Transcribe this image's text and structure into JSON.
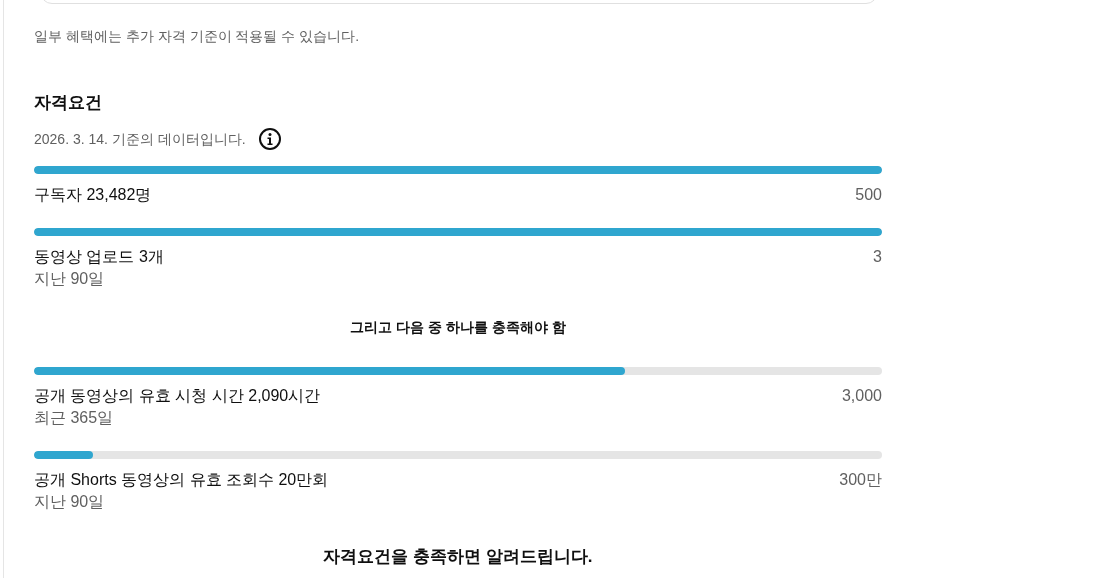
{
  "notice": "일부 혜택에는 추가 자격 기준이 적용될 수 있습니다.",
  "section": {
    "title": "자격요건",
    "as_of": "2026. 3. 14. 기준의 데이터입니다."
  },
  "required": [
    {
      "label": "구독자 23,482명",
      "target": "500",
      "level": 1
    },
    {
      "label": "동영상 업로드 3개",
      "period": "지난 90일",
      "target": "3",
      "level": 1
    }
  ],
  "divider_text": "그리고 다음 중 하나를 충족해야 함",
  "alternatives": [
    {
      "label": "공개 동영상의 유효 시청 시간 2,090시간",
      "period": "최근 365일",
      "target": "3,000",
      "level": 0.697
    },
    {
      "label": "공개 Shorts 동영상의 유효 조회수 20만회",
      "period": "지난 90일",
      "target": "300만",
      "level": 0.07
    }
  ],
  "footer": "자격요건을 충족하면 알려드립니다."
}
